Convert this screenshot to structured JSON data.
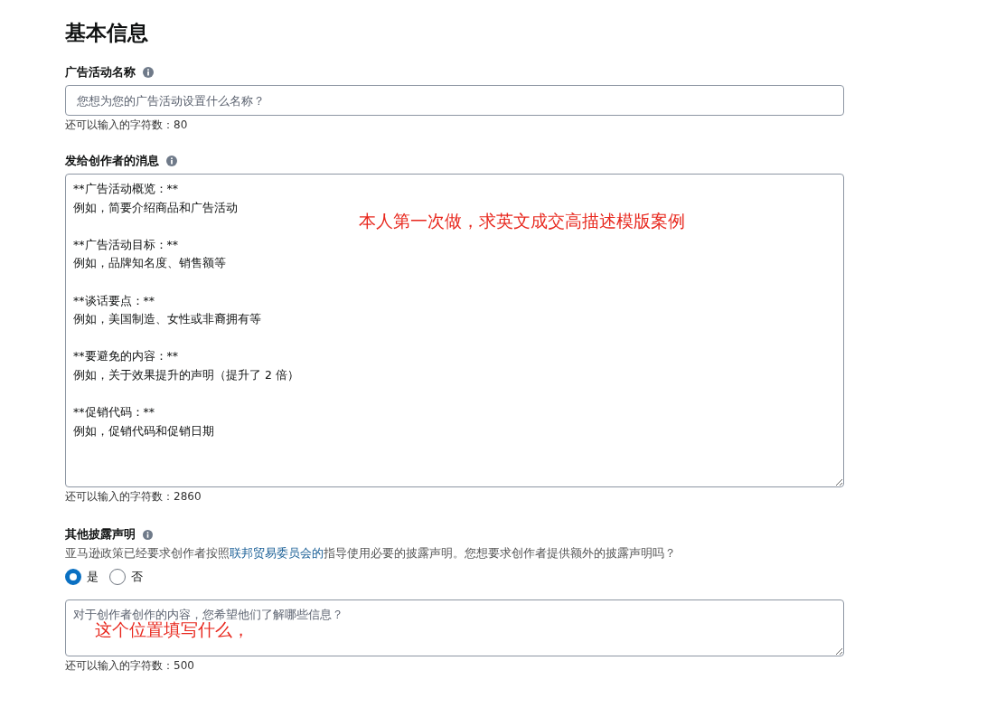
{
  "heading": "基本信息",
  "campaign_name": {
    "label": "广告活动名称",
    "placeholder": "您想为您的广告活动设置什么名称？",
    "remaining": "还可以输入的字符数：80"
  },
  "message": {
    "label": "发给创作者的消息",
    "value": "**广告活动概览：**\n例如，简要介绍商品和广告活动\n\n**广告活动目标：**\n例如，品牌知名度、销售额等\n\n**谈话要点：**\n例如，美国制造、女性或非裔拥有等\n\n**要避免的内容：**\n例如，关于效果提升的声明（提升了 2 倍）\n\n**促销代码：**\n例如，促销代码和促销日期",
    "remaining": "还可以输入的字符数：2860",
    "annotation": "本人第一次做，求英文成交高描述模版案例"
  },
  "disclosure": {
    "label": "其他披露声明",
    "text_before": "亚马逊政策已经要求创作者按照",
    "link": "联邦贸易委员会的",
    "text_after": "指导使用必要的披露声明。您想要求创作者提供额外的披露声明吗？",
    "options": [
      {
        "label": "是",
        "selected": true
      },
      {
        "label": "否",
        "selected": false
      }
    ],
    "placeholder": "对于创作者创作的内容，您希望他们了解哪些信息？",
    "annotation": "这个位置填写什么，",
    "remaining": "还可以输入的字符数：500"
  }
}
